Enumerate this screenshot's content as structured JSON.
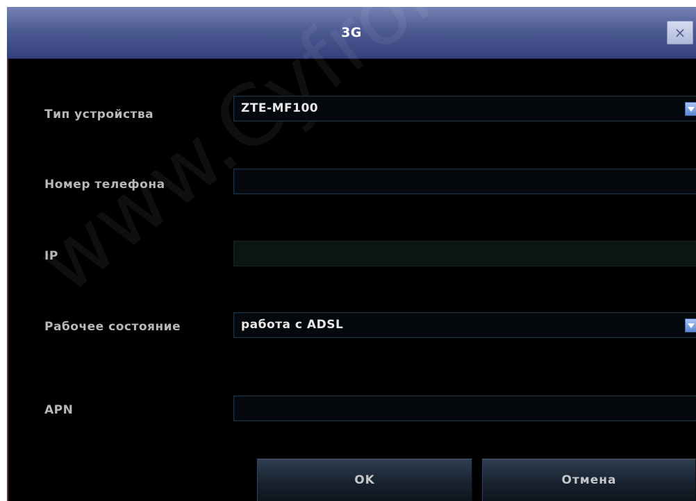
{
  "dialog": {
    "title": "3G",
    "close_icon": "close-icon",
    "close_glyph": "×"
  },
  "fields": {
    "device_type": {
      "label": "Тип устройства",
      "value": "ZTE-MF100",
      "icon": "chevron-down-icon"
    },
    "phone_number": {
      "label": "Номер телефона",
      "value": ""
    },
    "ip": {
      "label": "IP",
      "value": ""
    },
    "work_state": {
      "label": "Рабочее состояние",
      "value": "работа с ADSL",
      "icon": "chevron-down-icon"
    },
    "apn": {
      "label": "APN",
      "value": ""
    }
  },
  "buttons": {
    "ok_label": "OK",
    "cancel_label": "Отмена"
  },
  "watermark": {
    "text": "www.Cyfron.ru"
  },
  "colors": {
    "title_bar": "#4d5b93",
    "background": "#000000",
    "dropdown_accent": "#5b86d4"
  }
}
